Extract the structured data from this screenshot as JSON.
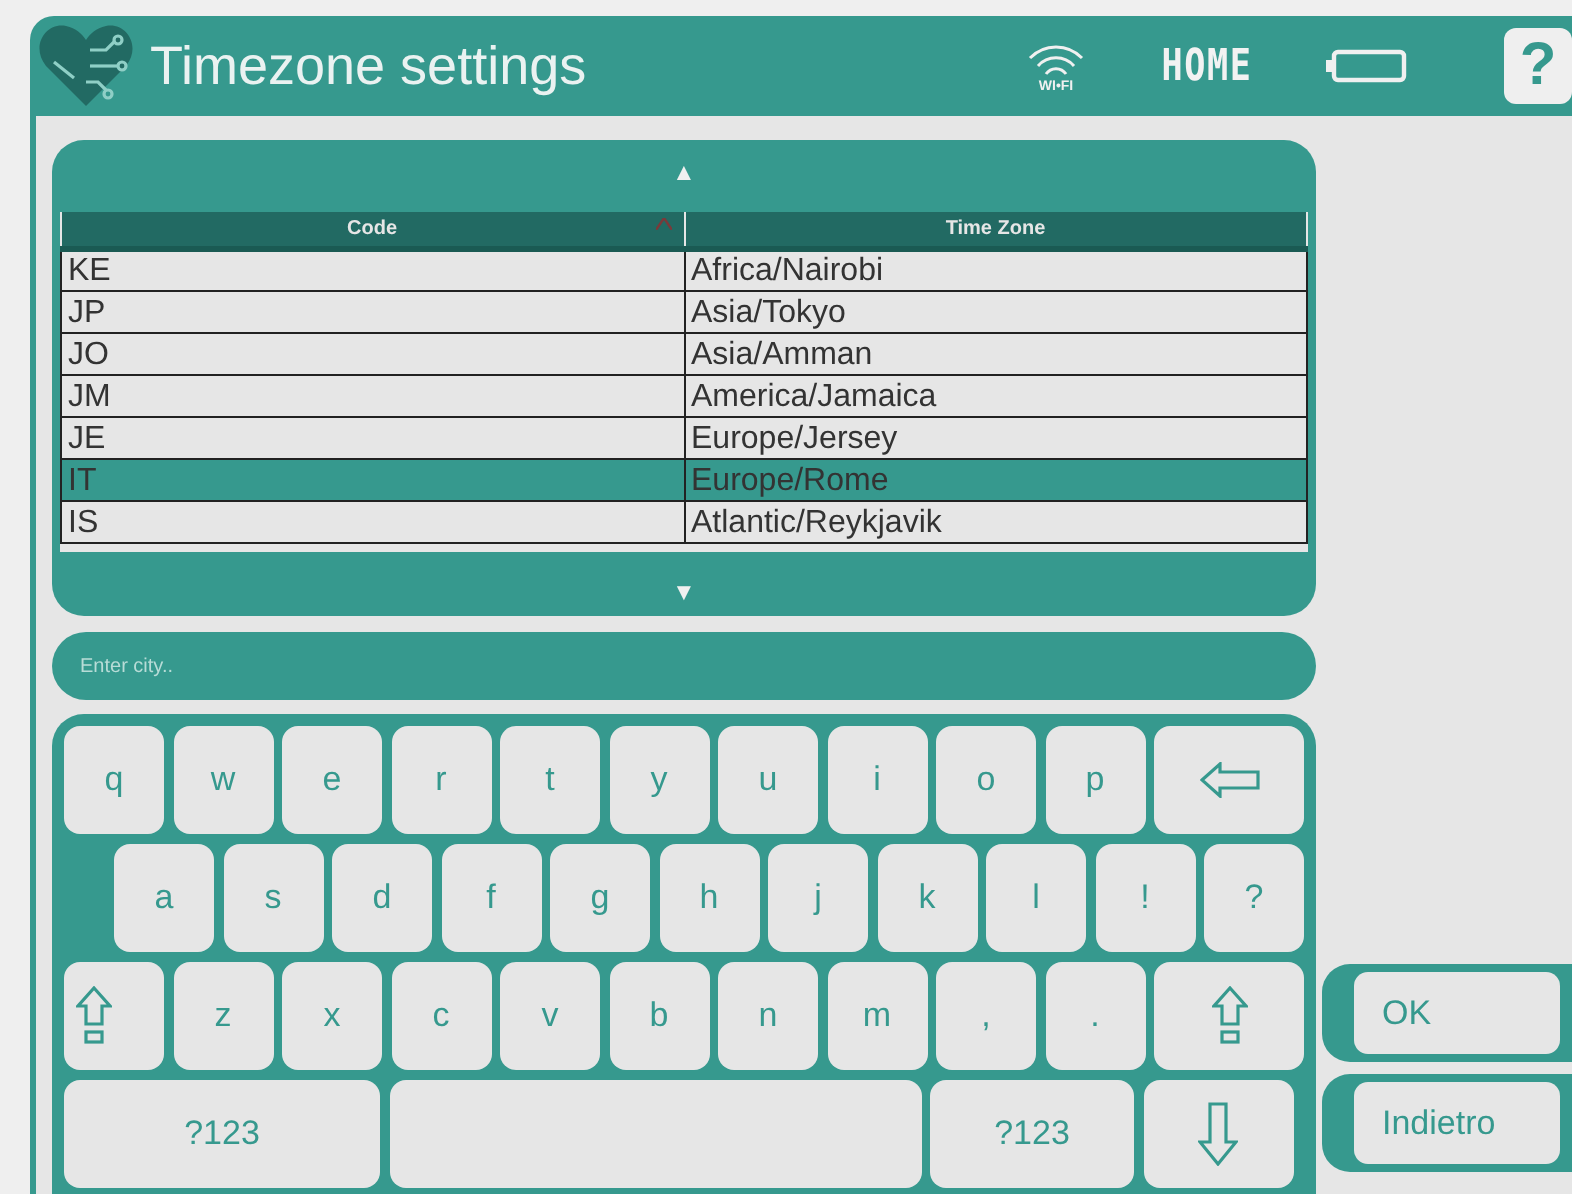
{
  "header": {
    "title": "Timezone settings",
    "wifi_label": "WI•FI",
    "home": "HOME",
    "help": "?"
  },
  "table": {
    "scroll_up": "▲",
    "scroll_down": "▼",
    "columns": [
      {
        "label": "Code",
        "sorted": true
      },
      {
        "label": "Time Zone",
        "sorted": false
      }
    ],
    "rows": [
      {
        "cells": [
          "KE",
          "Africa/Nairobi"
        ],
        "selected": false
      },
      {
        "cells": [
          "JP",
          "Asia/Tokyo"
        ],
        "selected": false
      },
      {
        "cells": [
          "JO",
          "Asia/Amman"
        ],
        "selected": false
      },
      {
        "cells": [
          "JM",
          "America/Jamaica"
        ],
        "selected": false
      },
      {
        "cells": [
          "JE",
          "Europe/Jersey"
        ],
        "selected": false
      },
      {
        "cells": [
          "IT",
          "Europe/Rome"
        ],
        "selected": true
      },
      {
        "cells": [
          "IS",
          "Atlantic/Reykjavik"
        ],
        "selected": false
      }
    ]
  },
  "search": {
    "placeholder": "Enter city.."
  },
  "keyboard": {
    "rows": [
      {
        "keys": [
          {
            "kind": "char",
            "label": "q"
          },
          {
            "kind": "char",
            "label": "w"
          },
          {
            "kind": "char",
            "label": "e"
          },
          {
            "kind": "char",
            "label": "r"
          },
          {
            "kind": "char",
            "label": "t"
          },
          {
            "kind": "char",
            "label": "y"
          },
          {
            "kind": "char",
            "label": "u"
          },
          {
            "kind": "char",
            "label": "i"
          },
          {
            "kind": "char",
            "label": "o"
          },
          {
            "kind": "char",
            "label": "p"
          },
          {
            "kind": "backspace"
          }
        ]
      },
      {
        "keys": [
          {
            "kind": "char",
            "label": "a"
          },
          {
            "kind": "char",
            "label": "s"
          },
          {
            "kind": "char",
            "label": "d"
          },
          {
            "kind": "char",
            "label": "f"
          },
          {
            "kind": "char",
            "label": "g"
          },
          {
            "kind": "char",
            "label": "h"
          },
          {
            "kind": "char",
            "label": "j"
          },
          {
            "kind": "char",
            "label": "k"
          },
          {
            "kind": "char",
            "label": "l"
          },
          {
            "kind": "char",
            "label": "!"
          },
          {
            "kind": "char",
            "label": "?"
          }
        ]
      },
      {
        "keys": [
          {
            "kind": "shift"
          },
          {
            "kind": "char",
            "label": "z"
          },
          {
            "kind": "char",
            "label": "x"
          },
          {
            "kind": "char",
            "label": "c"
          },
          {
            "kind": "char",
            "label": "v"
          },
          {
            "kind": "char",
            "label": "b"
          },
          {
            "kind": "char",
            "label": "n"
          },
          {
            "kind": "char",
            "label": "m"
          },
          {
            "kind": "char",
            "label": ","
          },
          {
            "kind": "char",
            "label": "."
          },
          {
            "kind": "shift"
          }
        ]
      },
      {
        "keys": [
          {
            "kind": "symbols",
            "label": "?123"
          },
          {
            "kind": "space"
          },
          {
            "kind": "symbols",
            "label": "?123"
          },
          {
            "kind": "hide"
          }
        ]
      }
    ]
  },
  "buttons": [
    "OK",
    "Indietro"
  ]
}
